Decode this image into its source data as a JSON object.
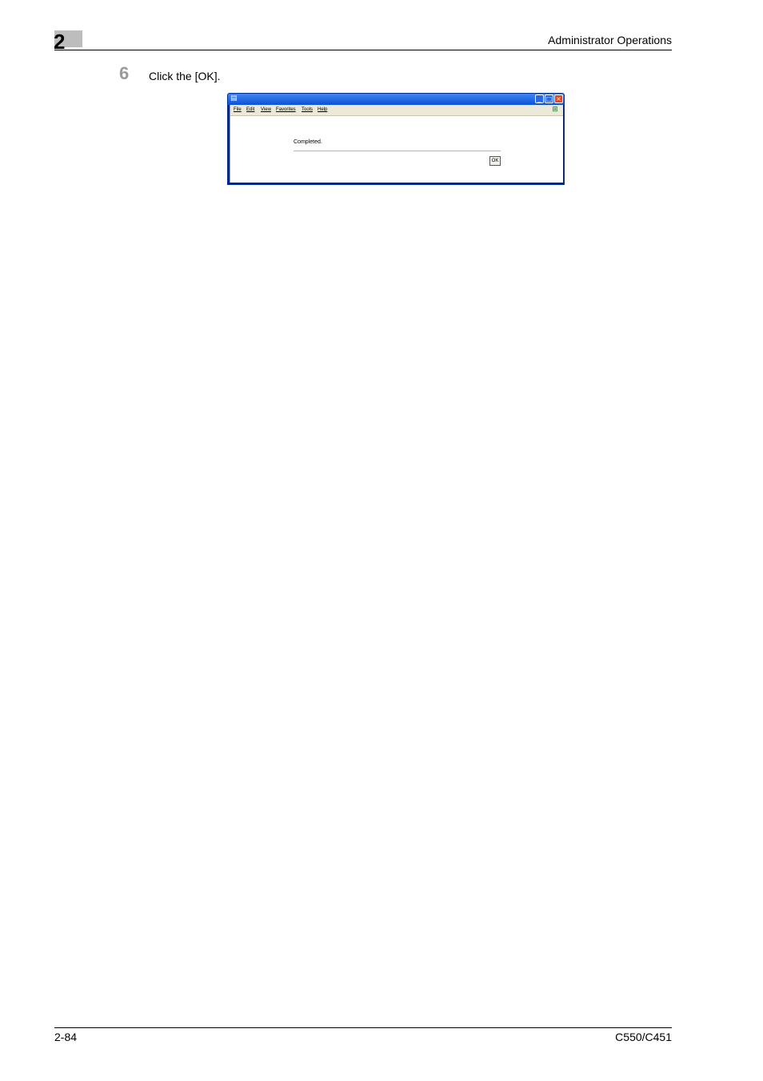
{
  "header": {
    "chapter_number": "2",
    "section_title": "Administrator Operations"
  },
  "step": {
    "number": "6",
    "instruction": "Click the [OK]."
  },
  "screenshot": {
    "titlebar": {
      "app_icon": "ie-page-icon",
      "minimize_glyph": "_",
      "maximize_glyph": "□",
      "close_glyph": "×"
    },
    "menu": [
      {
        "label": "File"
      },
      {
        "label": "Edit"
      },
      {
        "label": "View"
      },
      {
        "label": "Favorites"
      },
      {
        "label": "Tools"
      },
      {
        "label": "Help"
      }
    ],
    "windows_logo_icon": "windows-logo-icon",
    "message": "Completed.",
    "ok_label": "OK"
  },
  "footer": {
    "page_number": "2-84",
    "model": "C550/C451"
  }
}
